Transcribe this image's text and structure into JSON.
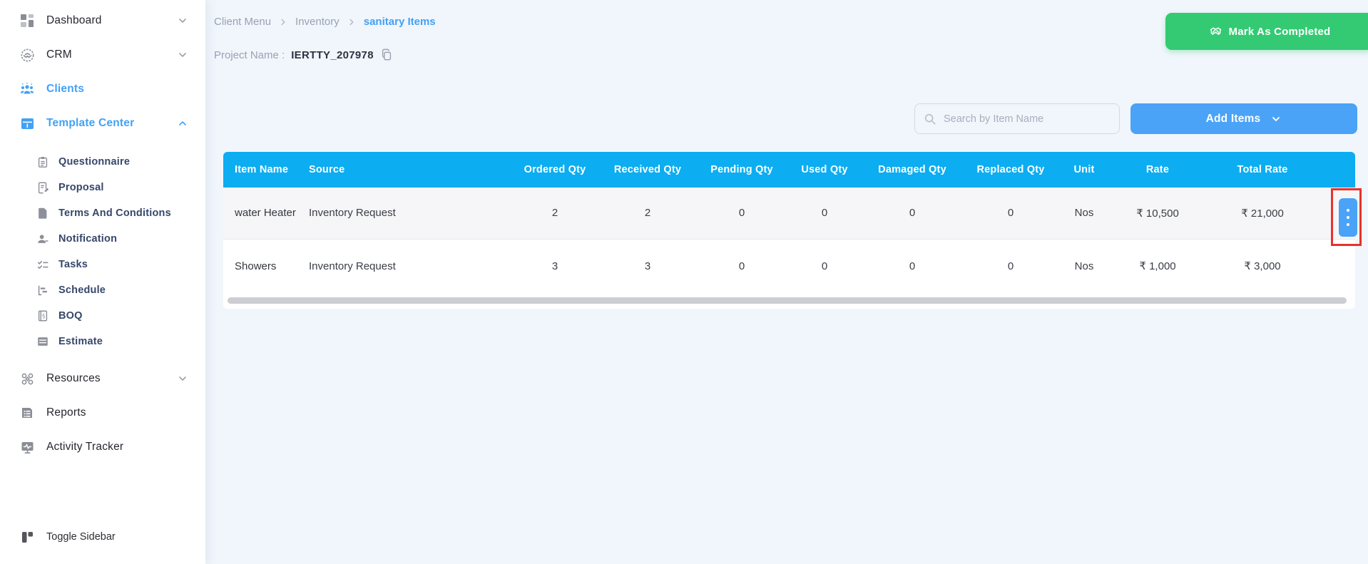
{
  "colors": {
    "table_header_blue": "#0cadf1",
    "primary_blue": "#4aa3f7",
    "active_link_blue": "#42a1f5",
    "success_green": "#33ca73",
    "chat_blue": "#1866c9",
    "annotation_red": "#e8322d"
  },
  "sidebar": {
    "main": [
      {
        "label": "Dashboard"
      },
      {
        "label": "CRM"
      },
      {
        "label": "Clients"
      },
      {
        "label": "Template Center"
      },
      {
        "label": "Resources"
      },
      {
        "label": "Reports"
      },
      {
        "label": "Activity Tracker"
      }
    ],
    "sub": [
      {
        "label": "Questionnaire"
      },
      {
        "label": "Proposal"
      },
      {
        "label": "Terms And Conditions"
      },
      {
        "label": "Notification"
      },
      {
        "label": "Tasks"
      },
      {
        "label": "Schedule"
      },
      {
        "label": "BOQ"
      },
      {
        "label": "Estimate"
      }
    ],
    "toggle_label": "Toggle Sidebar"
  },
  "breadcrumb": [
    "Client Menu",
    "Inventory",
    "sanitary Items"
  ],
  "project": {
    "label": "Project Name :",
    "value": "IERTTY_207978"
  },
  "actions": {
    "mark_completed_label": "Mark As Completed",
    "add_items_label": "Add Items"
  },
  "search": {
    "placeholder": "Search by Item Name"
  },
  "table": {
    "headers": [
      "Item Name",
      "Source",
      "Ordered Qty",
      "Received Qty",
      "Pending Qty",
      "Used Qty",
      "Damaged Qty",
      "Replaced Qty",
      "Unit",
      "Rate",
      "Total Rate"
    ],
    "rows": [
      {
        "item_name": "water Heater",
        "source": "Inventory Request",
        "ordered": "2",
        "received": "2",
        "pending": "0",
        "used": "0",
        "damaged": "0",
        "replaced": "0",
        "unit": "Nos",
        "rate": "₹ 10,500",
        "total_rate": "₹ 21,000"
      },
      {
        "item_name": "Showers",
        "source": "Inventory Request",
        "ordered": "3",
        "received": "3",
        "pending": "0",
        "used": "0",
        "damaged": "0",
        "replaced": "0",
        "unit": "Nos",
        "rate": "₹ 1,000",
        "total_rate": "₹ 3,000"
      }
    ]
  }
}
